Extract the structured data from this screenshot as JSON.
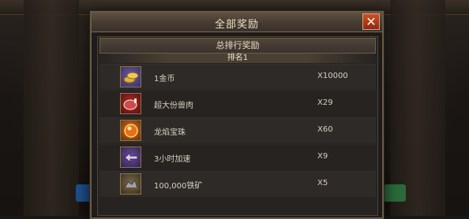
{
  "dialog": {
    "title": "全部奖励",
    "close_glyph": "✕",
    "section_title": "总排行奖励",
    "rank_label": "排名1"
  },
  "rewards": [
    {
      "name": "1金币",
      "qty": "X10000",
      "icon": "gold-coins-icon"
    },
    {
      "name": "超大份兽肉",
      "qty": "X29",
      "icon": "meat-icon"
    },
    {
      "name": "龙焰宝珠",
      "qty": "X60",
      "icon": "dragon-orb-icon"
    },
    {
      "name": "3小时加速",
      "qty": "X9",
      "icon": "speedup-icon"
    },
    {
      "name": "100,000铁矿",
      "qty": "X5",
      "icon": "iron-ore-icon"
    }
  ],
  "colors": {
    "title_text": "#efe3c8",
    "close_button": "#b8401f",
    "frame": "#6a5a44",
    "text": "#d9d0bc"
  }
}
